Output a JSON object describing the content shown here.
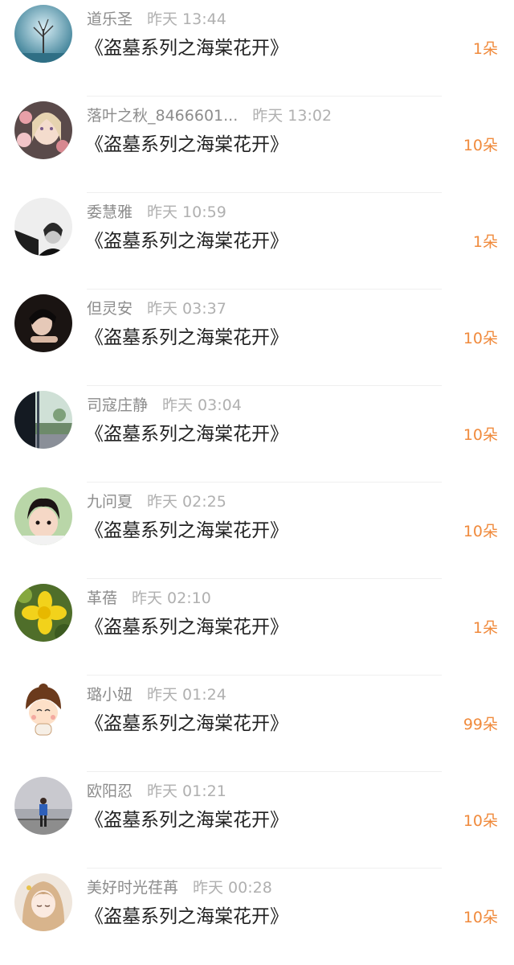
{
  "gift_list": [
    {
      "name": "道乐圣",
      "time": "昨天 13:44",
      "book": "《盗墓系列之海棠花开》",
      "count": "1朵",
      "avatar": "snow-tree-icon"
    },
    {
      "name": "落叶之秋_8466601...",
      "time": "昨天 13:02",
      "book": "《盗墓系列之海棠花开》",
      "count": "10朵",
      "avatar": "doll-portrait-icon"
    },
    {
      "name": "委慧雅",
      "time": "昨天 10:59",
      "book": "《盗墓系列之海棠花开》",
      "count": "1朵",
      "avatar": "bw-portrait-icon"
    },
    {
      "name": "但灵安",
      "time": "昨天 03:37",
      "book": "《盗墓系列之海棠花开》",
      "count": "10朵",
      "avatar": "dark-portrait-icon"
    },
    {
      "name": "司寇庄静",
      "time": "昨天 03:04",
      "book": "《盗墓系列之海棠花开》",
      "count": "10朵",
      "avatar": "window-scene-icon"
    },
    {
      "name": "九问夏",
      "time": "昨天 02:25",
      "book": "《盗墓系列之海棠花开》",
      "count": "10朵",
      "avatar": "child-portrait-icon"
    },
    {
      "name": "革蓓",
      "time": "昨天 02:10",
      "book": "《盗墓系列之海棠花开》",
      "count": "1朵",
      "avatar": "yellow-flower-icon"
    },
    {
      "name": "璐小妞",
      "time": "昨天 01:24",
      "book": "《盗墓系列之海棠花开》",
      "count": "99朵",
      "avatar": "cartoon-girl-icon"
    },
    {
      "name": "欧阳忍",
      "time": "昨天 01:21",
      "book": "《盗墓系列之海棠花开》",
      "count": "10朵",
      "avatar": "lakeside-person-icon"
    },
    {
      "name": "美好时光荏苒",
      "time": "昨天 00:28",
      "book": "《盗墓系列之海棠花开》",
      "count": "10朵",
      "avatar": "anime-girl-icon"
    }
  ],
  "colors": {
    "count": "#f08a3c",
    "title": "#222222",
    "meta": "#9a9a9a"
  }
}
